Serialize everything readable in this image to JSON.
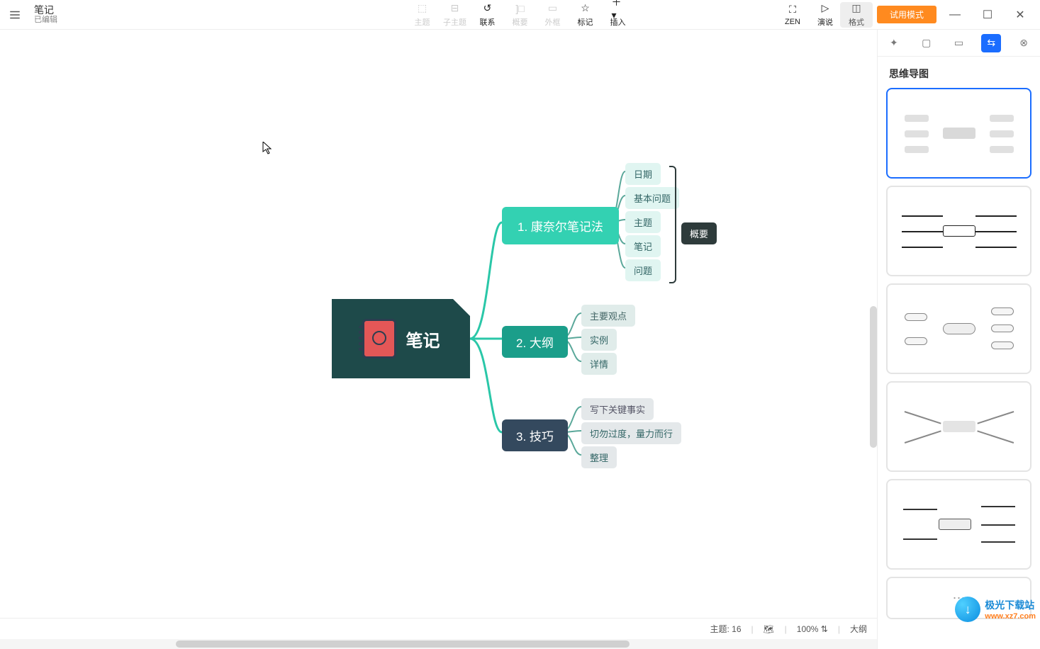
{
  "topbar": {
    "title": "笔记",
    "subtitle": "已编辑",
    "tools": {
      "topic": "主题",
      "subtopic": "子主题",
      "relation": "联系",
      "summary_tool": "概要",
      "boundary": "外框",
      "marker": "标记",
      "insert": "插入",
      "zen": "ZEN",
      "pitch": "演说",
      "format": "格式"
    },
    "trial": "试用模式"
  },
  "mindmap": {
    "root": "笔记",
    "b1": "1. 康奈尔笔记法",
    "b2": "2. 大纲",
    "b3": "3. 技巧",
    "l1": "日期",
    "l2": "基本问题",
    "l3": "主题",
    "l4": "笔记",
    "l5": "问题",
    "l6": "主要观点",
    "l7": "实例",
    "l8": "详情",
    "l9": "写下关键事实",
    "l10": "切勿过度，量力而行",
    "l11": "整理",
    "summary": "概要"
  },
  "rpanel": {
    "title": "思维导图"
  },
  "status": {
    "topic_label": "主题: 16",
    "zoom": "100%",
    "mode": "大纲"
  },
  "watermark": {
    "site": "极光下载站",
    "url": "www.xz7.com"
  }
}
